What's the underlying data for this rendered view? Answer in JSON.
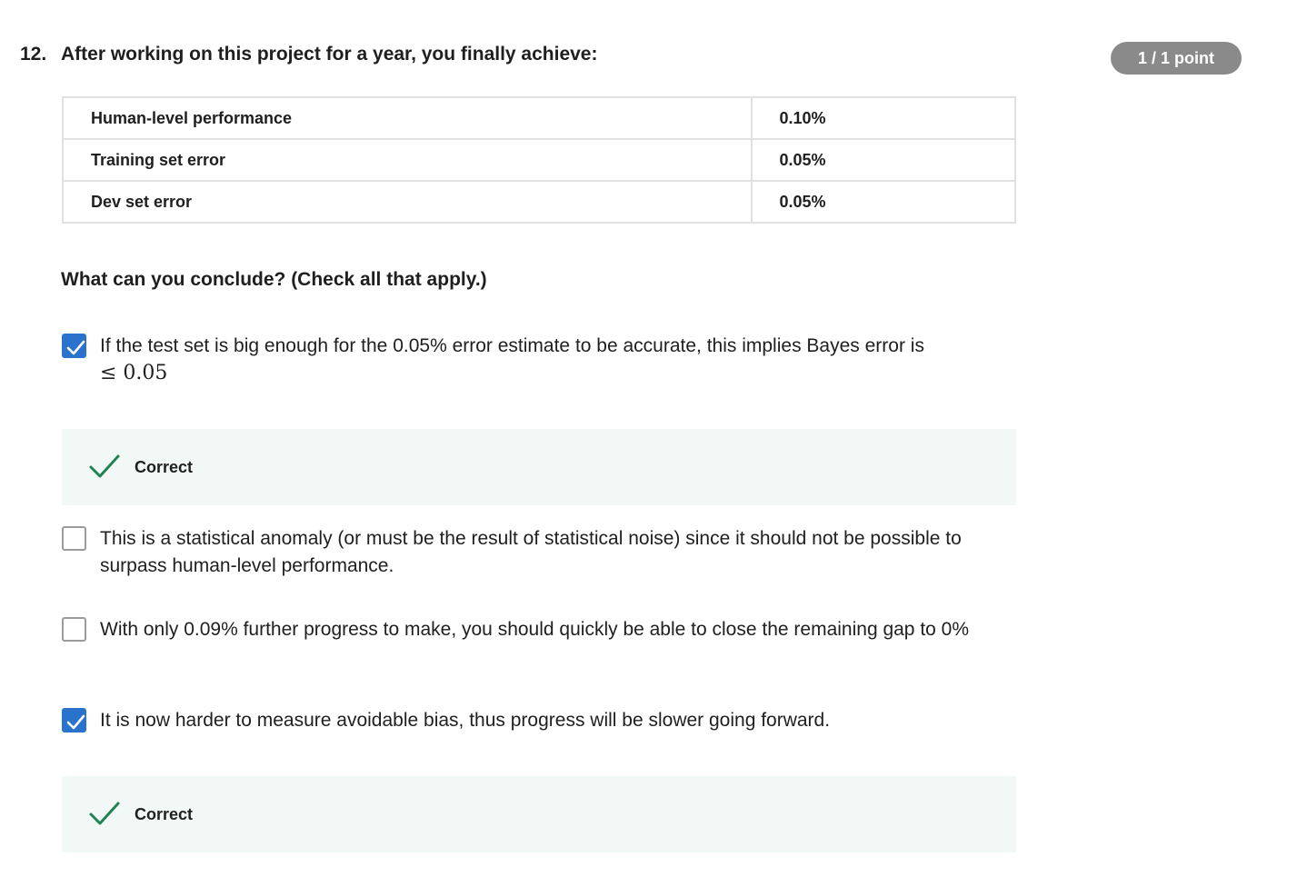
{
  "question": {
    "number": "12.",
    "title": "After working on this project for a year, you finally achieve:",
    "points": "1 / 1 point"
  },
  "results_table": [
    {
      "label": "Human-level performance",
      "value": "0.10%"
    },
    {
      "label": "Training set error",
      "value": "0.05%"
    },
    {
      "label": "Dev set error",
      "value": "0.05%"
    }
  ],
  "prompt": "What can you conclude? (Check all that apply.)",
  "options": [
    {
      "text": "If the test set is big enough for the 0.05% error estimate to be accurate, this implies Bayes error is",
      "math": "≤ 0.05",
      "checked": true,
      "feedback": "Correct"
    },
    {
      "text": "This is a statistical anomaly (or must be the result of statistical noise) since it should not be possible to surpass human-level performance.",
      "checked": false
    },
    {
      "text": "With only 0.09% further progress to make, you should quickly be able to close the remaining gap to 0%",
      "checked": false
    },
    {
      "text": "It is now harder to measure avoidable bias, thus progress will be slower going forward.",
      "checked": true,
      "feedback": "Correct"
    }
  ],
  "colors": {
    "checkbox_checked": "#2a73cc",
    "correct_icon": "#1f8354",
    "feedback_bg": "#f2f8f5",
    "badge_bg": "#8a8a8a"
  }
}
